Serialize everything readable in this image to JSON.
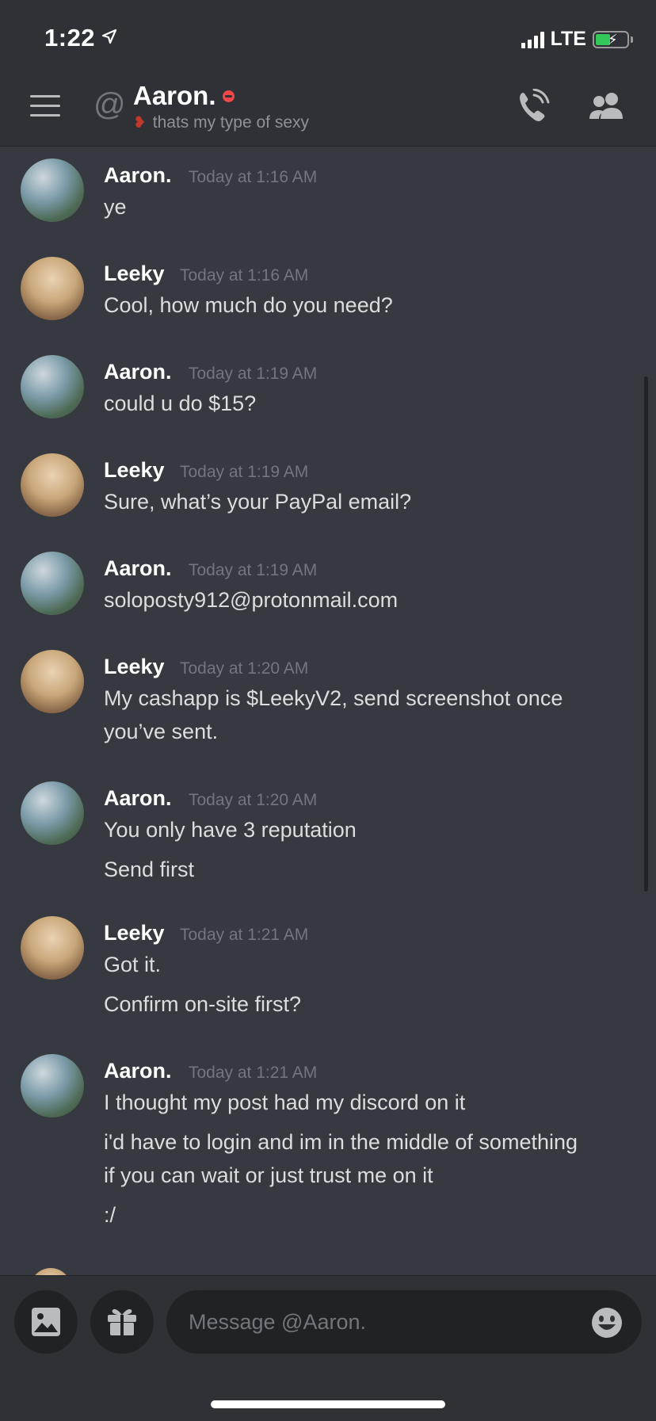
{
  "status_bar": {
    "time": "1:22",
    "network": "LTE"
  },
  "header": {
    "name": "Aaron.",
    "status_text": "thats my type of sexy"
  },
  "messages": [
    {
      "author": "Aaron.",
      "avatar": "aaron",
      "time": "Today at 1:16 AM",
      "lines": [
        "ye"
      ]
    },
    {
      "author": "Leeky",
      "avatar": "leeky",
      "time": "Today at 1:16 AM",
      "lines": [
        "Cool, how much do you need?"
      ]
    },
    {
      "author": "Aaron.",
      "avatar": "aaron",
      "time": "Today at 1:19 AM",
      "lines": [
        "could u do $15?"
      ]
    },
    {
      "author": "Leeky",
      "avatar": "leeky",
      "time": "Today at 1:19 AM",
      "lines": [
        "Sure, what’s your PayPal email?"
      ]
    },
    {
      "author": "Aaron.",
      "avatar": "aaron",
      "time": "Today at 1:19 AM",
      "lines": [
        "soloposty912@protonmail.com"
      ]
    },
    {
      "author": "Leeky",
      "avatar": "leeky",
      "time": "Today at 1:20 AM",
      "lines": [
        "My cashapp is $LeekyV2, send screenshot once",
        "you’ve sent."
      ]
    },
    {
      "author": "Aaron.",
      "avatar": "aaron",
      "time": "Today at 1:20 AM",
      "lines": [
        "You only have 3 reputation",
        "Send first"
      ]
    },
    {
      "author": "Leeky",
      "avatar": "leeky",
      "time": "Today at 1:21 AM",
      "lines": [
        "Got it.",
        "Confirm on-site first?"
      ]
    },
    {
      "author": "Aaron.",
      "avatar": "aaron",
      "time": "Today at 1:21 AM",
      "lines": [
        "I thought my post had my discord on it",
        "i'd have to login and im in the middle of something",
        "if you can wait or just trust me on it",
        ":/"
      ]
    }
  ],
  "composer": {
    "placeholder": "Message @Aaron."
  },
  "colors": {
    "background": "#36393f",
    "header": "#2f3136",
    "input": "#202225",
    "dnd": "#f04747",
    "muted": "#72767d"
  }
}
